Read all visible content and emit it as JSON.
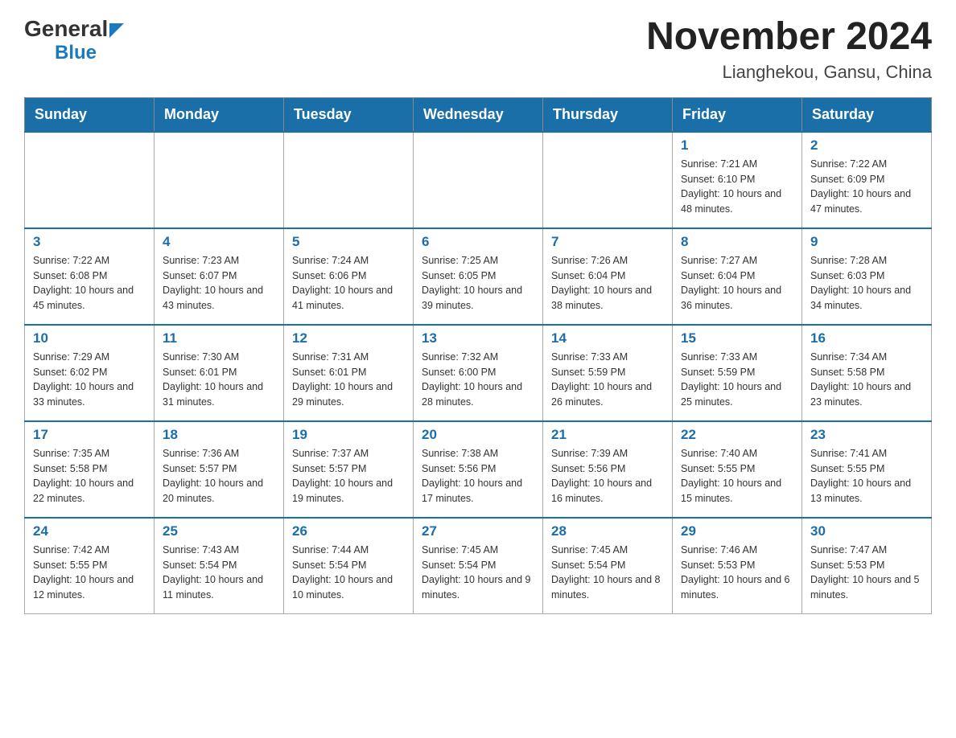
{
  "header": {
    "title": "November 2024",
    "subtitle": "Lianghekou, Gansu, China"
  },
  "logo": {
    "line1": "General",
    "line2": "Blue"
  },
  "weekdays": [
    "Sunday",
    "Monday",
    "Tuesday",
    "Wednesday",
    "Thursday",
    "Friday",
    "Saturday"
  ],
  "weeks": [
    [
      {
        "day": "",
        "info": ""
      },
      {
        "day": "",
        "info": ""
      },
      {
        "day": "",
        "info": ""
      },
      {
        "day": "",
        "info": ""
      },
      {
        "day": "",
        "info": ""
      },
      {
        "day": "1",
        "info": "Sunrise: 7:21 AM\nSunset: 6:10 PM\nDaylight: 10 hours and 48 minutes."
      },
      {
        "day": "2",
        "info": "Sunrise: 7:22 AM\nSunset: 6:09 PM\nDaylight: 10 hours and 47 minutes."
      }
    ],
    [
      {
        "day": "3",
        "info": "Sunrise: 7:22 AM\nSunset: 6:08 PM\nDaylight: 10 hours and 45 minutes."
      },
      {
        "day": "4",
        "info": "Sunrise: 7:23 AM\nSunset: 6:07 PM\nDaylight: 10 hours and 43 minutes."
      },
      {
        "day": "5",
        "info": "Sunrise: 7:24 AM\nSunset: 6:06 PM\nDaylight: 10 hours and 41 minutes."
      },
      {
        "day": "6",
        "info": "Sunrise: 7:25 AM\nSunset: 6:05 PM\nDaylight: 10 hours and 39 minutes."
      },
      {
        "day": "7",
        "info": "Sunrise: 7:26 AM\nSunset: 6:04 PM\nDaylight: 10 hours and 38 minutes."
      },
      {
        "day": "8",
        "info": "Sunrise: 7:27 AM\nSunset: 6:04 PM\nDaylight: 10 hours and 36 minutes."
      },
      {
        "day": "9",
        "info": "Sunrise: 7:28 AM\nSunset: 6:03 PM\nDaylight: 10 hours and 34 minutes."
      }
    ],
    [
      {
        "day": "10",
        "info": "Sunrise: 7:29 AM\nSunset: 6:02 PM\nDaylight: 10 hours and 33 minutes."
      },
      {
        "day": "11",
        "info": "Sunrise: 7:30 AM\nSunset: 6:01 PM\nDaylight: 10 hours and 31 minutes."
      },
      {
        "day": "12",
        "info": "Sunrise: 7:31 AM\nSunset: 6:01 PM\nDaylight: 10 hours and 29 minutes."
      },
      {
        "day": "13",
        "info": "Sunrise: 7:32 AM\nSunset: 6:00 PM\nDaylight: 10 hours and 28 minutes."
      },
      {
        "day": "14",
        "info": "Sunrise: 7:33 AM\nSunset: 5:59 PM\nDaylight: 10 hours and 26 minutes."
      },
      {
        "day": "15",
        "info": "Sunrise: 7:33 AM\nSunset: 5:59 PM\nDaylight: 10 hours and 25 minutes."
      },
      {
        "day": "16",
        "info": "Sunrise: 7:34 AM\nSunset: 5:58 PM\nDaylight: 10 hours and 23 minutes."
      }
    ],
    [
      {
        "day": "17",
        "info": "Sunrise: 7:35 AM\nSunset: 5:58 PM\nDaylight: 10 hours and 22 minutes."
      },
      {
        "day": "18",
        "info": "Sunrise: 7:36 AM\nSunset: 5:57 PM\nDaylight: 10 hours and 20 minutes."
      },
      {
        "day": "19",
        "info": "Sunrise: 7:37 AM\nSunset: 5:57 PM\nDaylight: 10 hours and 19 minutes."
      },
      {
        "day": "20",
        "info": "Sunrise: 7:38 AM\nSunset: 5:56 PM\nDaylight: 10 hours and 17 minutes."
      },
      {
        "day": "21",
        "info": "Sunrise: 7:39 AM\nSunset: 5:56 PM\nDaylight: 10 hours and 16 minutes."
      },
      {
        "day": "22",
        "info": "Sunrise: 7:40 AM\nSunset: 5:55 PM\nDaylight: 10 hours and 15 minutes."
      },
      {
        "day": "23",
        "info": "Sunrise: 7:41 AM\nSunset: 5:55 PM\nDaylight: 10 hours and 13 minutes."
      }
    ],
    [
      {
        "day": "24",
        "info": "Sunrise: 7:42 AM\nSunset: 5:55 PM\nDaylight: 10 hours and 12 minutes."
      },
      {
        "day": "25",
        "info": "Sunrise: 7:43 AM\nSunset: 5:54 PM\nDaylight: 10 hours and 11 minutes."
      },
      {
        "day": "26",
        "info": "Sunrise: 7:44 AM\nSunset: 5:54 PM\nDaylight: 10 hours and 10 minutes."
      },
      {
        "day": "27",
        "info": "Sunrise: 7:45 AM\nSunset: 5:54 PM\nDaylight: 10 hours and 9 minutes."
      },
      {
        "day": "28",
        "info": "Sunrise: 7:45 AM\nSunset: 5:54 PM\nDaylight: 10 hours and 8 minutes."
      },
      {
        "day": "29",
        "info": "Sunrise: 7:46 AM\nSunset: 5:53 PM\nDaylight: 10 hours and 6 minutes."
      },
      {
        "day": "30",
        "info": "Sunrise: 7:47 AM\nSunset: 5:53 PM\nDaylight: 10 hours and 5 minutes."
      }
    ]
  ]
}
